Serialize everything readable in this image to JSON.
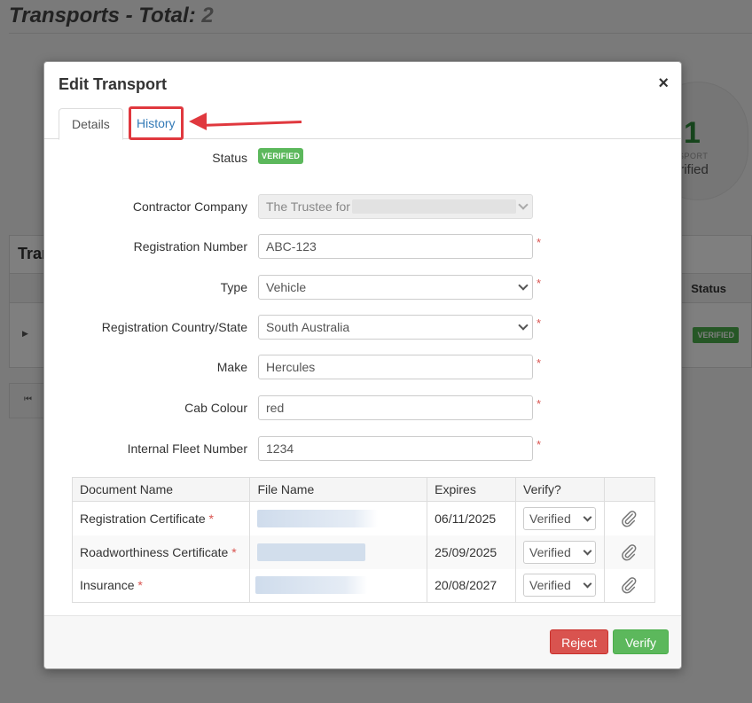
{
  "background": {
    "page_title": "Transports - Total:",
    "total_count": "2",
    "stat_number": "1",
    "stat_label_small": "NSPORT",
    "stat_label": "erified",
    "panel_title": "Tran",
    "status_header": "Status",
    "row_status_badge": "VERIFIED"
  },
  "modal": {
    "title": "Edit Transport",
    "close_label": "×",
    "tabs": [
      {
        "label": "Details",
        "active": true
      },
      {
        "label": "History",
        "active": false,
        "highlighted": true
      }
    ],
    "fields": {
      "status": {
        "label": "Status",
        "value": "VERIFIED"
      },
      "contractor_company": {
        "label": "Contractor Company",
        "value": "The Trustee for"
      },
      "registration_number": {
        "label": "Registration Number",
        "value": "ABC-123",
        "required": "*"
      },
      "type": {
        "label": "Type",
        "value": "Vehicle",
        "required": "*"
      },
      "registration_country_state": {
        "label": "Registration Country/State",
        "value": "South Australia",
        "required": "*"
      },
      "make": {
        "label": "Make",
        "value": "Hercules",
        "required": "*"
      },
      "cab_colour": {
        "label": "Cab Colour",
        "value": "red",
        "required": "*"
      },
      "internal_fleet_number": {
        "label": "Internal Fleet Number",
        "value": "1234",
        "required": "*"
      }
    },
    "documents": {
      "headers": [
        "Document Name",
        "File Name",
        "Expires",
        "Verify?",
        ""
      ],
      "rows": [
        {
          "name": "Registration Certificate",
          "required": "*",
          "expires": "06/11/2025",
          "verify": "Verified"
        },
        {
          "name": "Roadworthiness Certificate",
          "required": "*",
          "expires": "25/09/2025",
          "verify": "Verified"
        },
        {
          "name": "Insurance",
          "required": "*",
          "expires": "20/08/2027",
          "verify": "Verified"
        }
      ]
    },
    "footer": {
      "reject_label": "Reject",
      "verify_label": "Verify"
    }
  },
  "colors": {
    "accent_red": "#d9534f",
    "accent_green": "#5cb85c",
    "link_blue": "#337ab7",
    "annotation_red": "#e0383e"
  }
}
